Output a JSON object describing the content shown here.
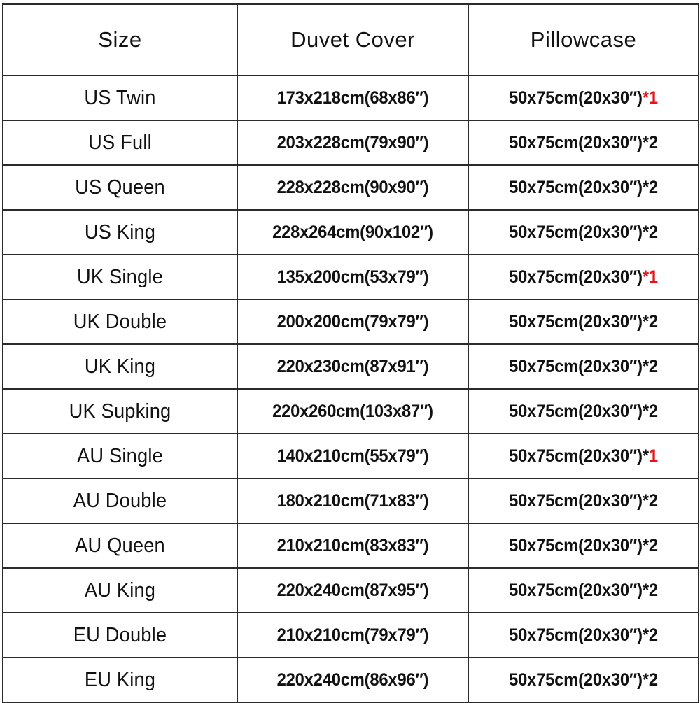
{
  "table": {
    "headers": {
      "size": "Size",
      "duvet": "Duvet Cover",
      "pillow": "Pillowcase"
    },
    "accent_color": "#e8131a",
    "border_color": "#2b2b2b",
    "rows": [
      {
        "size": "US Twin",
        "duvet": "173x218cm(68x86″)",
        "pillow_base": "50x75cm(20x30″)",
        "pillow_star": "*",
        "pillow_count": "1",
        "star_color": "red",
        "count_color": "red"
      },
      {
        "size": "US Full",
        "duvet": "203x228cm(79x90″)",
        "pillow_base": "50x75cm(20x30″)",
        "pillow_star": "*",
        "pillow_count": "2",
        "star_color": "black",
        "count_color": "black"
      },
      {
        "size": "US Queen",
        "duvet": "228x228cm(90x90″)",
        "pillow_base": "50x75cm(20x30″)",
        "pillow_star": "*",
        "pillow_count": "2",
        "star_color": "black",
        "count_color": "black"
      },
      {
        "size": "US King",
        "duvet": "228x264cm(90x102″)",
        "pillow_base": "50x75cm(20x30″)",
        "pillow_star": "*",
        "pillow_count": "2",
        "star_color": "black",
        "count_color": "black"
      },
      {
        "size": "UK Single",
        "duvet": "135x200cm(53x79″)",
        "pillow_base": "50x75cm(20x30″)",
        "pillow_star": "*",
        "pillow_count": "1",
        "star_color": "red",
        "count_color": "red"
      },
      {
        "size": "UK Double",
        "duvet": "200x200cm(79x79″)",
        "pillow_base": "50x75cm(20x30″)",
        "pillow_star": "*",
        "pillow_count": "2",
        "star_color": "black",
        "count_color": "black"
      },
      {
        "size": "UK King",
        "duvet": "220x230cm(87x91″)",
        "pillow_base": "50x75cm(20x30″)",
        "pillow_star": "*",
        "pillow_count": "2",
        "star_color": "black",
        "count_color": "black"
      },
      {
        "size": "UK Supking",
        "duvet": "220x260cm(103x87″)",
        "pillow_base": "50x75cm(20x30″)",
        "pillow_star": "*",
        "pillow_count": "2",
        "star_color": "black",
        "count_color": "black"
      },
      {
        "size": "AU Single",
        "duvet": "140x210cm(55x79″)",
        "pillow_base": "50x75cm(20x30″)",
        "pillow_star": "*",
        "pillow_count": "1",
        "star_color": "black",
        "count_color": "red"
      },
      {
        "size": "AU Double",
        "duvet": "180x210cm(71x83″)",
        "pillow_base": "50x75cm(20x30″)",
        "pillow_star": "*",
        "pillow_count": "2",
        "star_color": "black",
        "count_color": "black"
      },
      {
        "size": "AU Queen",
        "duvet": "210x210cm(83x83″)",
        "pillow_base": "50x75cm(20x30″)",
        "pillow_star": "*",
        "pillow_count": "2",
        "star_color": "black",
        "count_color": "black"
      },
      {
        "size": "AU King",
        "duvet": "220x240cm(87x95″)",
        "pillow_base": "50x75cm(20x30″)",
        "pillow_star": "*",
        "pillow_count": "2",
        "star_color": "black",
        "count_color": "black"
      },
      {
        "size": "EU Double",
        "duvet": "210x210cm(79x79″)",
        "pillow_base": "50x75cm(20x30″)",
        "pillow_star": "*",
        "pillow_count": "2",
        "star_color": "black",
        "count_color": "black"
      },
      {
        "size": "EU King",
        "duvet": "220x240cm(86x96″)",
        "pillow_base": "50x75cm(20x30″)",
        "pillow_star": "*",
        "pillow_count": "2",
        "star_color": "black",
        "count_color": "black"
      }
    ]
  }
}
